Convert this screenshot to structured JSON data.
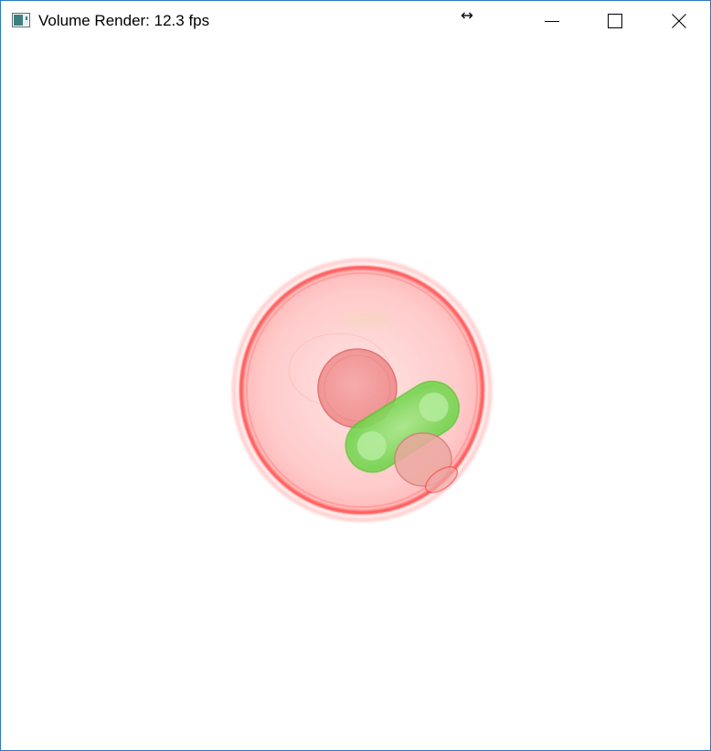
{
  "window": {
    "title": "Volume Render: 12.3 fps",
    "icons": {
      "app": "app-window-icon",
      "resize": "horizontal-resize-icon",
      "minimize": "minimize-icon",
      "maximize": "maximize-icon",
      "close": "close-icon"
    }
  },
  "render": {
    "colors": {
      "membrane": "#ff2a2a",
      "cytoplasm": "#ffc8c8",
      "nucleus": "#f08a8a",
      "organelle": "#5fd23a"
    }
  }
}
